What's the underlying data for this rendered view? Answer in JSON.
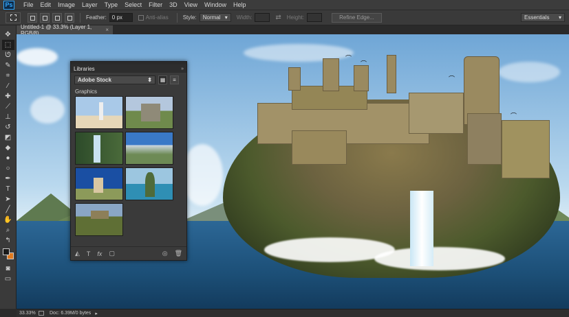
{
  "app": {
    "logo": "Ps"
  },
  "menu": [
    "File",
    "Edit",
    "Image",
    "Layer",
    "Type",
    "Select",
    "Filter",
    "3D",
    "View",
    "Window",
    "Help"
  ],
  "options": {
    "feather_label": "Feather:",
    "feather_value": "0 px",
    "antialias_label": "Anti-alias",
    "style_label": "Style:",
    "style_value": "Normal",
    "width_label": "Width:",
    "height_label": "Height:",
    "refine_edge": "Refine Edge...",
    "workspace": "Essentials"
  },
  "document_tab": {
    "title": "Untitled-1 @ 33.3% (Layer 1, RGB/8)",
    "close": "×"
  },
  "libraries": {
    "title": "Libraries",
    "collapse": "»",
    "menu": "≡",
    "library_name": "Adobe Stock",
    "section": "Graphics",
    "thumbnails": [
      {
        "subject": "lighthouse",
        "colors": [
          "#a9c9e8",
          "#e6d7b8"
        ]
      },
      {
        "subject": "castle-ruins",
        "colors": [
          "#b4c7dd",
          "#8f8a78"
        ]
      },
      {
        "subject": "waterfall",
        "colors": [
          "#2d4b2a",
          "#c9e2f0"
        ]
      },
      {
        "subject": "mountains",
        "colors": [
          "#3a79c7",
          "#6d8a55"
        ]
      },
      {
        "subject": "windmill",
        "colors": [
          "#1a4fa3",
          "#d9c7a2"
        ]
      },
      {
        "subject": "rock-island",
        "colors": [
          "#5aa0c9",
          "#4f6b3a"
        ]
      },
      {
        "subject": "fortress-hill",
        "colors": [
          "#8aa6c5",
          "#5f6f35"
        ]
      }
    ]
  },
  "status": {
    "zoom": "33.33%",
    "doc": "Doc: 6.39M/0 bytes"
  },
  "colors": {
    "foreground": "#1a1a1a",
    "background": "#e07a1f",
    "accent": "#31a8ff"
  }
}
